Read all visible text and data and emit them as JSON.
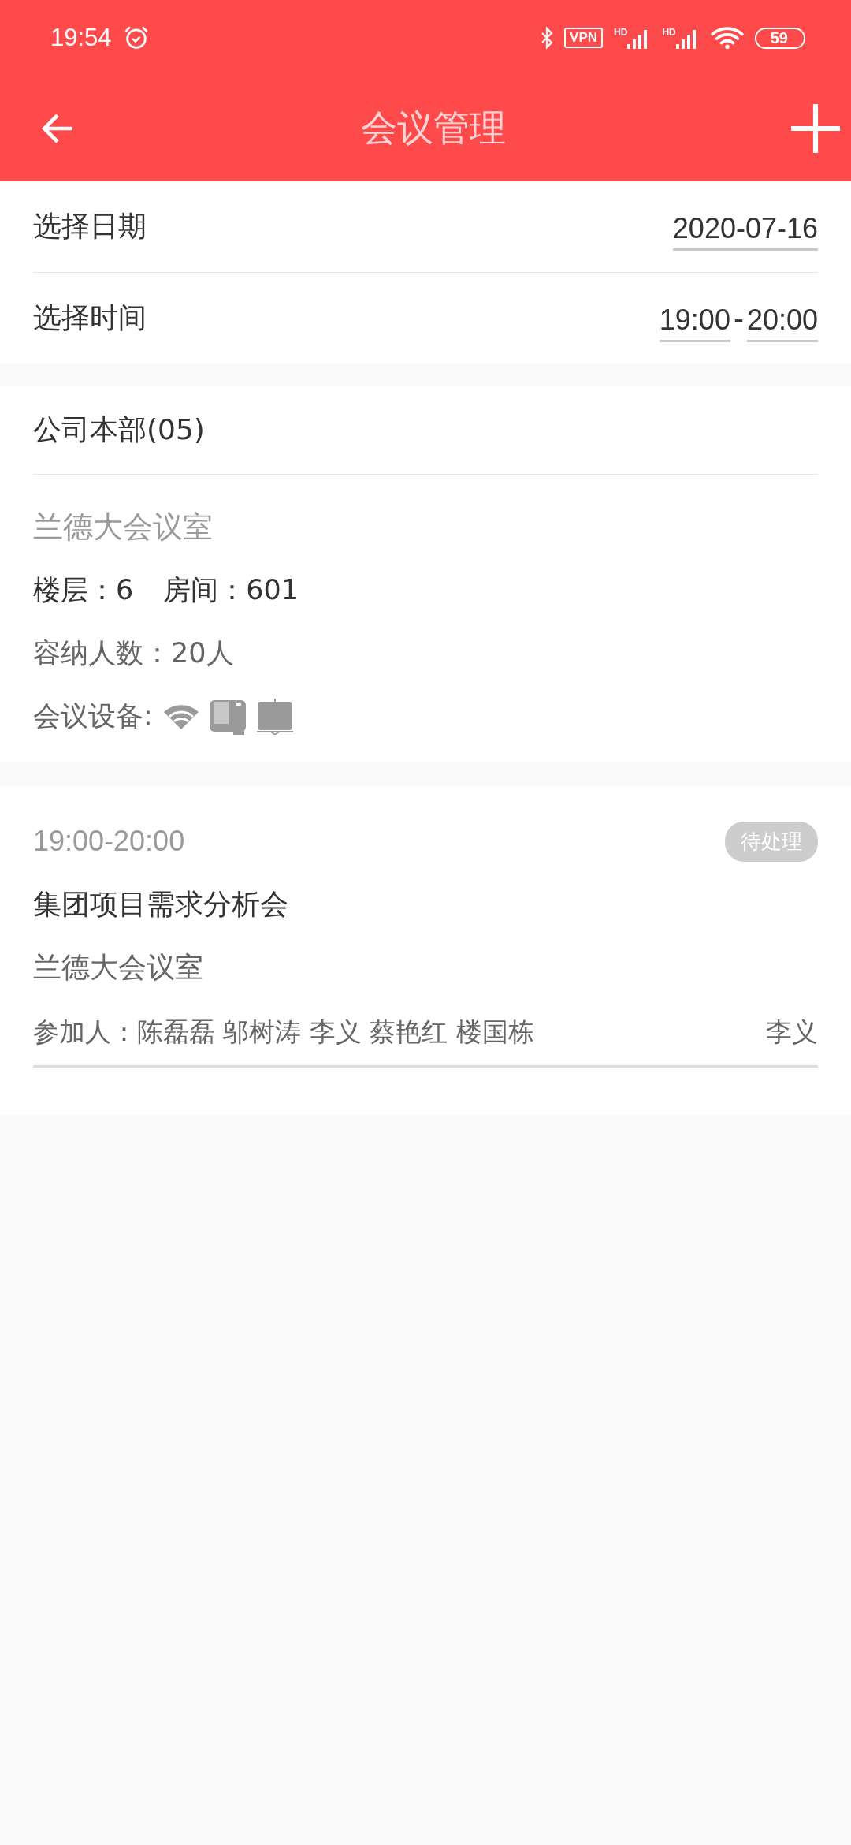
{
  "status_bar": {
    "time": "19:54",
    "vpn": "VPN",
    "signals": [
      {
        "label": "HD"
      },
      {
        "label": "HD"
      }
    ],
    "battery": "59"
  },
  "header": {
    "title": "会议管理"
  },
  "filters": [
    {
      "kind": "date",
      "label": "选择日期",
      "values": [
        "2020-07-16"
      ]
    },
    {
      "kind": "time",
      "label": "选择时间",
      "values": [
        "19:00",
        "20:00"
      ],
      "separator": "-"
    }
  ],
  "room_section": {
    "heading": "公司本部(05)",
    "room": {
      "name": "兰德大会议室",
      "floor": "楼层：6",
      "number": "房间：601",
      "capacity": "容纳人数：20人",
      "equipment_label": "会议设备:",
      "equipment": [
        {
          "kind": "wifi"
        },
        {
          "kind": "projector"
        },
        {
          "kind": "screen"
        }
      ]
    }
  },
  "meetings": [
    {
      "time": "19:00-20:00",
      "status": "待处理",
      "title": "集团项目需求分析会",
      "room": "兰德大会议室",
      "participants": "参加人：陈磊磊 邬树涛 李义 蔡艳红 楼国栋",
      "host": "李义"
    }
  ]
}
